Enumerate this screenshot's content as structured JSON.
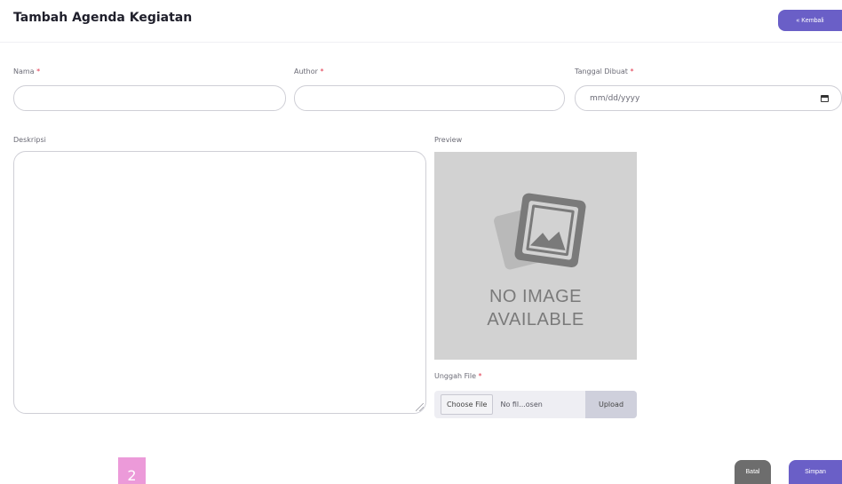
{
  "header": {
    "title": "Tambah Agenda Kegiatan",
    "back_label": "« Kembali"
  },
  "form": {
    "required_mark": "*",
    "nama_label": "Nama",
    "nama_value": "",
    "author_label": "Author",
    "author_value": "",
    "tanggal_label": "Tanggal Dibuat",
    "tanggal_placeholder": "mm/dd/yyyy",
    "deskripsi_label": "Deskripsi",
    "deskripsi_value": "",
    "preview_label": "Preview",
    "preview_placeholder_line1": "NO IMAGE",
    "preview_placeholder_line2": "AVAILABLE",
    "unggah_label": "Unggah File",
    "choose_file_label": "Choose File",
    "file_name": "No fil...osen",
    "upload_label": "Upload"
  },
  "pagination": {
    "current_page": "2"
  },
  "actions": {
    "cancel_label": "Batal",
    "save_label": "Simpan"
  },
  "colors": {
    "primary": "#6a5fc7",
    "cancel": "#6d6d6d",
    "required": "#e0344b",
    "page_badge": "#ec9ad9"
  },
  "icons": {
    "no_image": "image-placeholder-icon",
    "calendar": "calendar-icon"
  }
}
